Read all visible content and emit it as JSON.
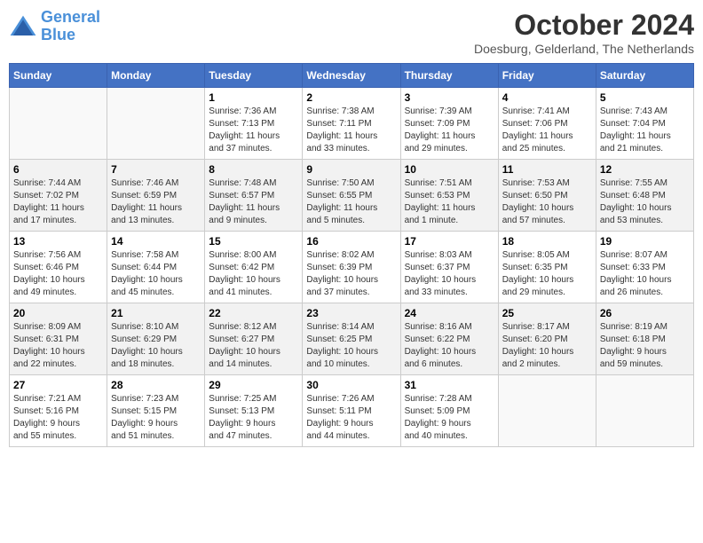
{
  "header": {
    "logo_line1": "General",
    "logo_line2": "Blue",
    "month_title": "October 2024",
    "location": "Doesburg, Gelderland, The Netherlands"
  },
  "weekdays": [
    "Sunday",
    "Monday",
    "Tuesday",
    "Wednesday",
    "Thursday",
    "Friday",
    "Saturday"
  ],
  "weeks": [
    [
      {
        "day": "",
        "info": ""
      },
      {
        "day": "",
        "info": ""
      },
      {
        "day": "1",
        "info": "Sunrise: 7:36 AM\nSunset: 7:13 PM\nDaylight: 11 hours\nand 37 minutes."
      },
      {
        "day": "2",
        "info": "Sunrise: 7:38 AM\nSunset: 7:11 PM\nDaylight: 11 hours\nand 33 minutes."
      },
      {
        "day": "3",
        "info": "Sunrise: 7:39 AM\nSunset: 7:09 PM\nDaylight: 11 hours\nand 29 minutes."
      },
      {
        "day": "4",
        "info": "Sunrise: 7:41 AM\nSunset: 7:06 PM\nDaylight: 11 hours\nand 25 minutes."
      },
      {
        "day": "5",
        "info": "Sunrise: 7:43 AM\nSunset: 7:04 PM\nDaylight: 11 hours\nand 21 minutes."
      }
    ],
    [
      {
        "day": "6",
        "info": "Sunrise: 7:44 AM\nSunset: 7:02 PM\nDaylight: 11 hours\nand 17 minutes."
      },
      {
        "day": "7",
        "info": "Sunrise: 7:46 AM\nSunset: 6:59 PM\nDaylight: 11 hours\nand 13 minutes."
      },
      {
        "day": "8",
        "info": "Sunrise: 7:48 AM\nSunset: 6:57 PM\nDaylight: 11 hours\nand 9 minutes."
      },
      {
        "day": "9",
        "info": "Sunrise: 7:50 AM\nSunset: 6:55 PM\nDaylight: 11 hours\nand 5 minutes."
      },
      {
        "day": "10",
        "info": "Sunrise: 7:51 AM\nSunset: 6:53 PM\nDaylight: 11 hours\nand 1 minute."
      },
      {
        "day": "11",
        "info": "Sunrise: 7:53 AM\nSunset: 6:50 PM\nDaylight: 10 hours\nand 57 minutes."
      },
      {
        "day": "12",
        "info": "Sunrise: 7:55 AM\nSunset: 6:48 PM\nDaylight: 10 hours\nand 53 minutes."
      }
    ],
    [
      {
        "day": "13",
        "info": "Sunrise: 7:56 AM\nSunset: 6:46 PM\nDaylight: 10 hours\nand 49 minutes."
      },
      {
        "day": "14",
        "info": "Sunrise: 7:58 AM\nSunset: 6:44 PM\nDaylight: 10 hours\nand 45 minutes."
      },
      {
        "day": "15",
        "info": "Sunrise: 8:00 AM\nSunset: 6:42 PM\nDaylight: 10 hours\nand 41 minutes."
      },
      {
        "day": "16",
        "info": "Sunrise: 8:02 AM\nSunset: 6:39 PM\nDaylight: 10 hours\nand 37 minutes."
      },
      {
        "day": "17",
        "info": "Sunrise: 8:03 AM\nSunset: 6:37 PM\nDaylight: 10 hours\nand 33 minutes."
      },
      {
        "day": "18",
        "info": "Sunrise: 8:05 AM\nSunset: 6:35 PM\nDaylight: 10 hours\nand 29 minutes."
      },
      {
        "day": "19",
        "info": "Sunrise: 8:07 AM\nSunset: 6:33 PM\nDaylight: 10 hours\nand 26 minutes."
      }
    ],
    [
      {
        "day": "20",
        "info": "Sunrise: 8:09 AM\nSunset: 6:31 PM\nDaylight: 10 hours\nand 22 minutes."
      },
      {
        "day": "21",
        "info": "Sunrise: 8:10 AM\nSunset: 6:29 PM\nDaylight: 10 hours\nand 18 minutes."
      },
      {
        "day": "22",
        "info": "Sunrise: 8:12 AM\nSunset: 6:27 PM\nDaylight: 10 hours\nand 14 minutes."
      },
      {
        "day": "23",
        "info": "Sunrise: 8:14 AM\nSunset: 6:25 PM\nDaylight: 10 hours\nand 10 minutes."
      },
      {
        "day": "24",
        "info": "Sunrise: 8:16 AM\nSunset: 6:22 PM\nDaylight: 10 hours\nand 6 minutes."
      },
      {
        "day": "25",
        "info": "Sunrise: 8:17 AM\nSunset: 6:20 PM\nDaylight: 10 hours\nand 2 minutes."
      },
      {
        "day": "26",
        "info": "Sunrise: 8:19 AM\nSunset: 6:18 PM\nDaylight: 9 hours\nand 59 minutes."
      }
    ],
    [
      {
        "day": "27",
        "info": "Sunrise: 7:21 AM\nSunset: 5:16 PM\nDaylight: 9 hours\nand 55 minutes."
      },
      {
        "day": "28",
        "info": "Sunrise: 7:23 AM\nSunset: 5:15 PM\nDaylight: 9 hours\nand 51 minutes."
      },
      {
        "day": "29",
        "info": "Sunrise: 7:25 AM\nSunset: 5:13 PM\nDaylight: 9 hours\nand 47 minutes."
      },
      {
        "day": "30",
        "info": "Sunrise: 7:26 AM\nSunset: 5:11 PM\nDaylight: 9 hours\nand 44 minutes."
      },
      {
        "day": "31",
        "info": "Sunrise: 7:28 AM\nSunset: 5:09 PM\nDaylight: 9 hours\nand 40 minutes."
      },
      {
        "day": "",
        "info": ""
      },
      {
        "day": "",
        "info": ""
      }
    ]
  ]
}
